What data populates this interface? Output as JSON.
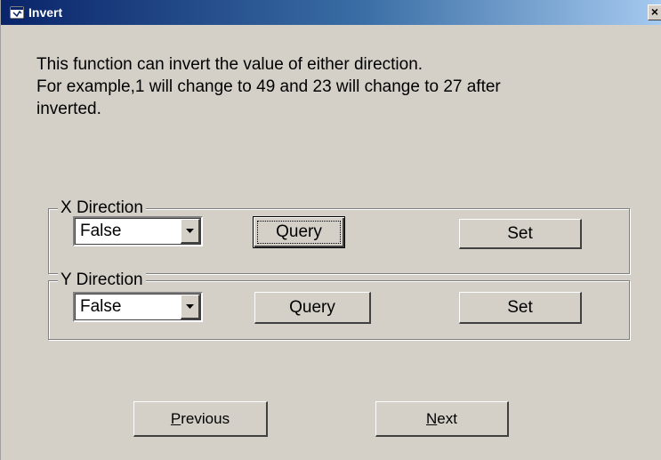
{
  "window": {
    "title": "Invert",
    "close_glyph": "×",
    "icon": "app-window-icon"
  },
  "description": {
    "line1": "This function can invert the value of either direction.",
    "line2": "For example,1 will change to 49 and 23 will change to 27 after",
    "line3": "inverted."
  },
  "x_direction": {
    "label": "X Direction",
    "selected": "False",
    "query_label": "Query",
    "set_label": "Set"
  },
  "y_direction": {
    "label": "Y Direction",
    "selected": "False",
    "query_label": "Query",
    "set_label": "Set"
  },
  "nav": {
    "previous_label_mnemonic": "P",
    "previous_label_rest": "revious",
    "next_label_mnemonic": "N",
    "next_label_rest": "ext"
  },
  "colors": {
    "face": "#d4d0c8",
    "title_start": "#0a246a",
    "title_end": "#a6caf0"
  }
}
